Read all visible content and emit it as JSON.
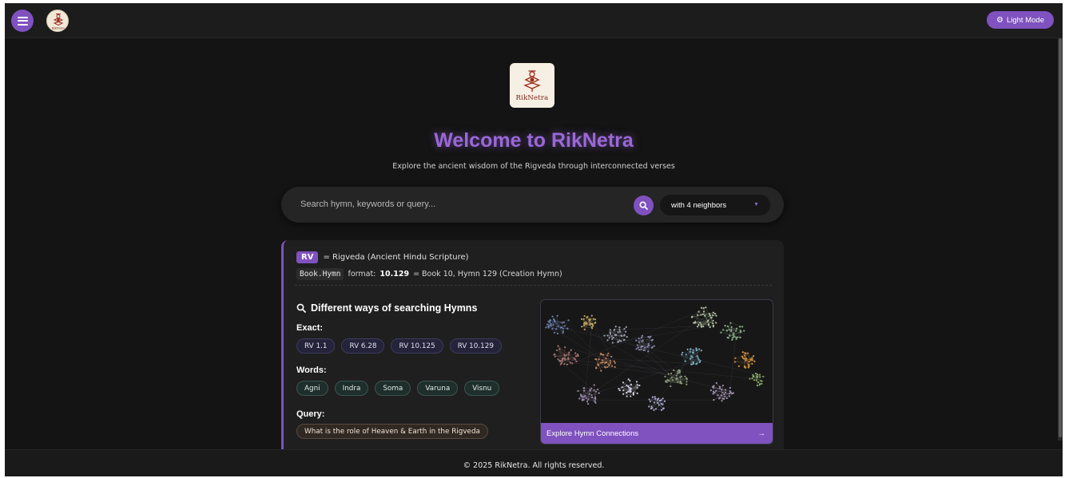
{
  "nav": {
    "menu_icon": "hamburger-icon",
    "avatar_icon": "riknetra-logo-icon",
    "avatar_text": "RikNetra",
    "mode_toggle_icon": "gear-icon",
    "mode_toggle_label": "Light Mode"
  },
  "hero": {
    "logo_text": "RikNetra",
    "title": "Welcome to RikNetra",
    "subtitle": "Explore the ancient wisdom of the Rigveda through interconnected verses"
  },
  "search": {
    "placeholder": "Search hymn, keywords or query...",
    "value": "",
    "button_icon": "search-icon",
    "neighbors_selected": "with 4 neighbors"
  },
  "info": {
    "rv_badge": "RV",
    "rv_text": "= Rigveda (Ancient Hindu Scripture)",
    "format_code": "Book.Hymn",
    "format_prefix": "format:",
    "format_example": "10.129",
    "format_text": "= Book 10, Hymn 129 (Creation Hymn)"
  },
  "ways": {
    "title": "Different ways of searching Hymns",
    "title_icon": "search-icon",
    "exact_label": "Exact:",
    "exact": [
      "RV 1.1",
      "RV 6.28",
      "RV 10.125",
      "RV 10.129"
    ],
    "words_label": "Words:",
    "words": [
      "Agni",
      "Indra",
      "Soma",
      "Varuna",
      "Visnu"
    ],
    "query_label": "Query:",
    "queries": [
      "What is the role of Heaven & Earth in the Rigveda"
    ]
  },
  "graph": {
    "label": "Explore Hymn Connections",
    "arrow_icon": "arrow-right-icon"
  },
  "footer": {
    "text": "© 2025 RikNetra. All rights reserved."
  },
  "colors": {
    "accent": "#7f52bf",
    "title": "#9a68d8",
    "background": "#141414",
    "panel": "#1f1f1f"
  }
}
